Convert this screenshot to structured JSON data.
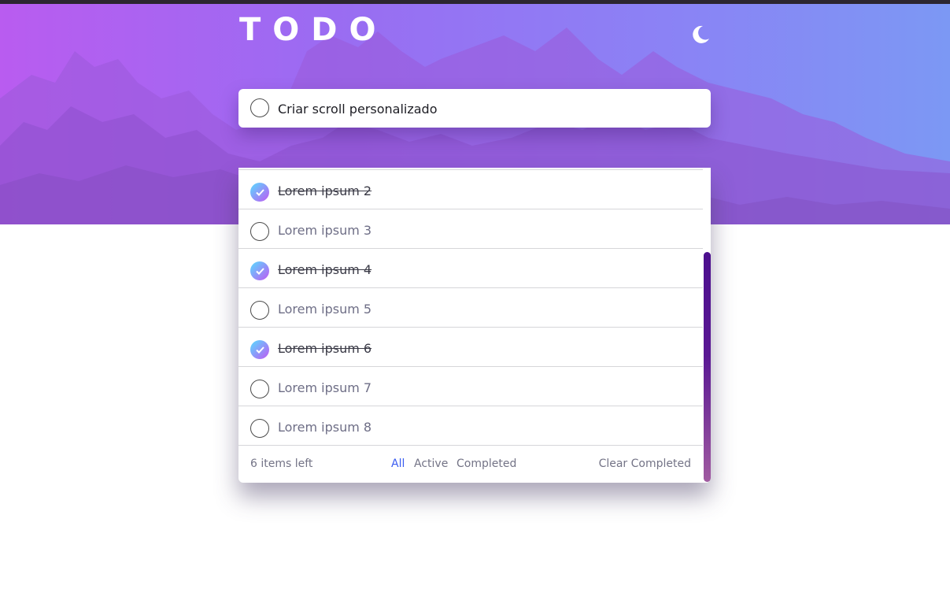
{
  "header": {
    "title": "TODO",
    "theme_icon": "moon-icon"
  },
  "new_todo": {
    "value": "Criar scroll personalizado"
  },
  "todos": [
    {
      "label": "Lorem ipsum 2",
      "completed": true
    },
    {
      "label": "Lorem ipsum 3",
      "completed": false
    },
    {
      "label": "Lorem ipsum 4",
      "completed": true
    },
    {
      "label": "Lorem ipsum 5",
      "completed": false
    },
    {
      "label": "Lorem ipsum 6",
      "completed": true
    },
    {
      "label": "Lorem ipsum 7",
      "completed": false
    },
    {
      "label": "Lorem ipsum 8",
      "completed": false
    }
  ],
  "footer": {
    "items_left": "6 items left",
    "filters": [
      "All",
      "Active",
      "Completed"
    ],
    "active_filter": "All",
    "clear_label": "Clear Completed"
  },
  "colors": {
    "check_gradient_start": "#57ddff",
    "check_gradient_end": "#c058f3",
    "active_filter": "#3a5cf0",
    "scrollbar": "#4c0f8e"
  }
}
